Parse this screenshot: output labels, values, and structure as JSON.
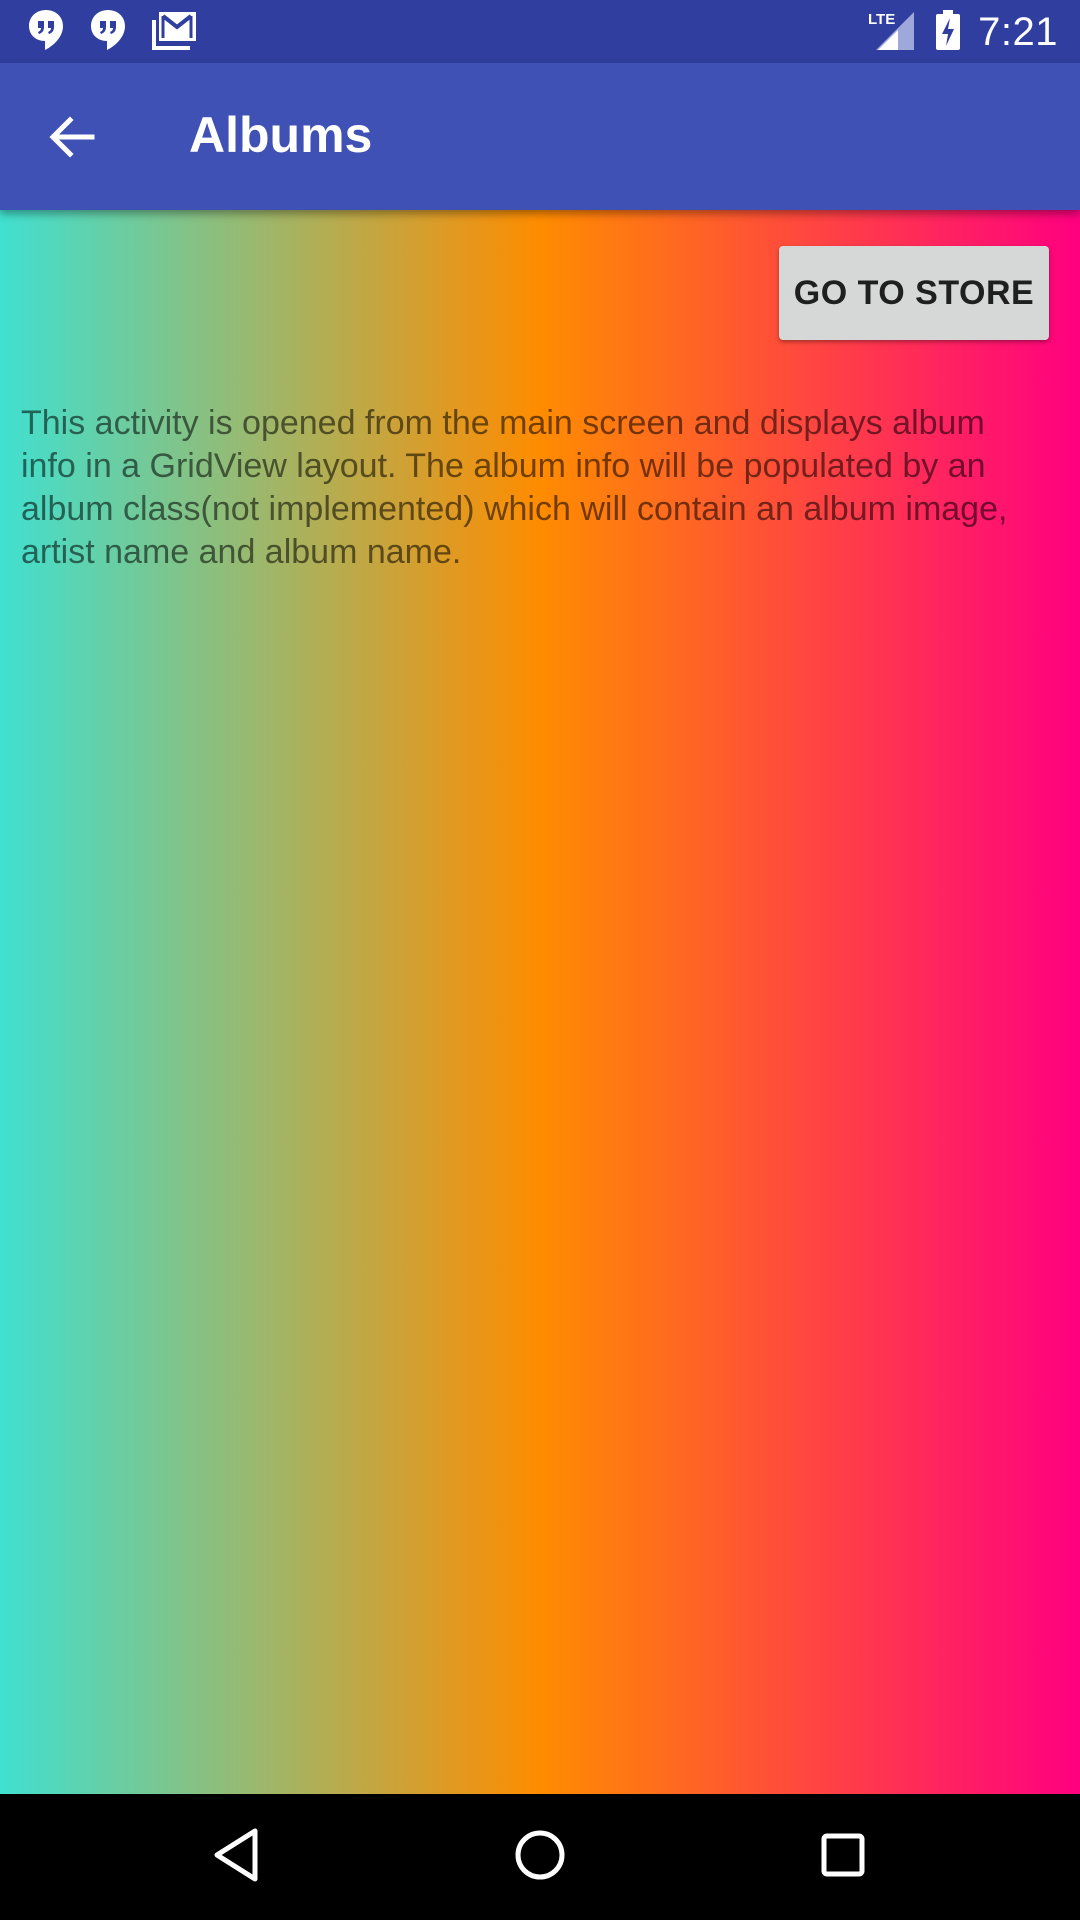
{
  "status_bar": {
    "time": "7:21",
    "network": "LTE",
    "icons": [
      "hangouts-icon",
      "hangouts-icon",
      "gmail-icon",
      "lte-signal-icon",
      "battery-charging-icon"
    ]
  },
  "app_bar": {
    "title": "Albums",
    "back_icon": "arrow-back-icon"
  },
  "main": {
    "store_button_label": "GO TO STORE",
    "description": "This activity is opened from the main screen and displays album info in a GridView layout. The album info will be populated by an album class(not implemented) which will contain an album image, artist name and album name."
  },
  "nav_bar": {
    "icons": [
      "back-triangle-icon",
      "home-circle-icon",
      "recents-square-icon"
    ]
  },
  "colors": {
    "status_bar": "#303f9f",
    "app_bar": "#3f51b5",
    "gradient_start": "#40e0d0",
    "gradient_mid": "#ff8c00",
    "gradient_end": "#ff0080",
    "button_bg": "#d6d7d7"
  }
}
